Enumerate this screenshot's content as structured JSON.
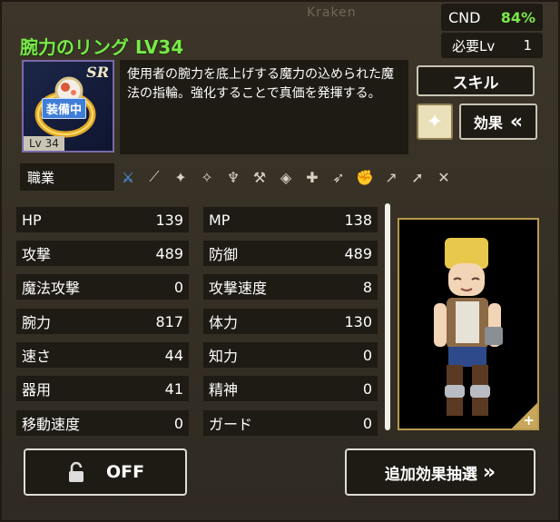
{
  "watermark": "Kraken",
  "item": {
    "name": "腕力のリング LV34",
    "rarity": "SR",
    "equipped_label": "装備中",
    "level_tag": "Lv 34",
    "description": "使用者の腕力を底上げする魔力の込められた魔法の指輪。強化することで真価を発揮する。"
  },
  "condition": {
    "label": "CND",
    "value": "84%"
  },
  "required_level": {
    "label": "必要Lv",
    "value": "1"
  },
  "buttons": {
    "skill": "スキル",
    "effect": "効果",
    "effect_chevron": "«",
    "lock_toggle": "OFF",
    "extra_effect_lottery": "追加効果抽選",
    "lottery_chevron": "»"
  },
  "job": {
    "label": "職業",
    "icons": [
      "sword-icon",
      "staff-icon",
      "wand-icon",
      "claw-icon",
      "mace-icon",
      "axe-icon",
      "tome-icon",
      "rod-icon",
      "bow-icon",
      "fist-icon",
      "dagger-icon",
      "spear-icon",
      "crossed-swords-icon"
    ],
    "active_index": 0
  },
  "stats_left": [
    {
      "label": "HP",
      "value": "139"
    },
    {
      "label": "攻撃",
      "value": "489"
    },
    {
      "label": "魔法攻撃",
      "value": "0"
    },
    {
      "label": "腕力",
      "value": "817"
    },
    {
      "label": "速さ",
      "value": "44"
    },
    {
      "label": "器用",
      "value": "41"
    },
    {
      "label": "移動速度",
      "value": "0"
    }
  ],
  "stats_right": [
    {
      "label": "MP",
      "value": "138"
    },
    {
      "label": "防御",
      "value": "489"
    },
    {
      "label": "攻撃速度",
      "value": "8"
    },
    {
      "label": "体力",
      "value": "130"
    },
    {
      "label": "知力",
      "value": "0"
    },
    {
      "label": "精神",
      "value": "0"
    },
    {
      "label": "ガード",
      "value": "0"
    }
  ],
  "colors": {
    "title_green": "#7be84a",
    "panel_dark": "#1e1a14",
    "frame_gold": "#b89a4c"
  }
}
